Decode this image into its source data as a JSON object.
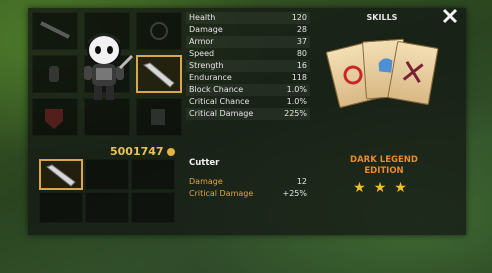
{
  "inventory": {
    "gold": "5001747"
  },
  "stats": [
    {
      "label": "Health",
      "value": "120"
    },
    {
      "label": "Damage",
      "value": "28"
    },
    {
      "label": "Armor",
      "value": "37"
    },
    {
      "label": "Speed",
      "value": "80"
    },
    {
      "label": "Strength",
      "value": "16"
    },
    {
      "label": "Endurance",
      "value": "118"
    },
    {
      "label": "Block Chance",
      "value": "1.0%"
    },
    {
      "label": "Critical Chance",
      "value": "1.0%"
    },
    {
      "label": "Critical Damage",
      "value": "225%"
    }
  ],
  "weapon": {
    "name": "Cutter",
    "rows": [
      {
        "label": "Damage",
        "value": "12"
      },
      {
        "label": "Critical Damage",
        "value": "+25%"
      }
    ]
  },
  "skills": {
    "title": "SKILLS",
    "edition_line1": "DARK LEGEND",
    "edition_line2": "EDITION",
    "stars": 3
  },
  "colors": {
    "accent": "#d9a64a",
    "orange": "#e88a2a",
    "gold": "#e8c05a"
  }
}
